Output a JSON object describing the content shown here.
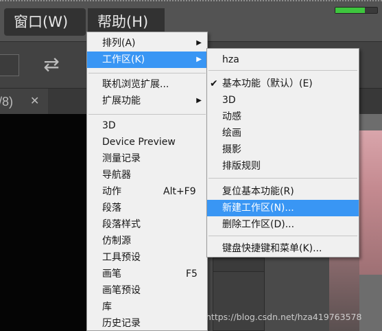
{
  "menubar": {
    "window_label": "窗口(W)",
    "help_label": "帮助(H)",
    "progress_fraction": 0.7,
    "progress_color": "#3ec63e"
  },
  "document_tab": {
    "text": "/8)",
    "close_glyph": "✕"
  },
  "window_menu": {
    "items": [
      {
        "label": "排列(A)",
        "shortcut": "",
        "submenu": true
      },
      {
        "label": "工作区(K)",
        "shortcut": "",
        "submenu": true,
        "highlighted": true
      },
      {
        "label": "联机浏览扩展...",
        "shortcut": ""
      },
      {
        "label": "扩展功能",
        "shortcut": "",
        "submenu": true
      },
      {
        "label": "3D",
        "shortcut": ""
      },
      {
        "label": "Device Preview",
        "shortcut": ""
      },
      {
        "label": "测量记录",
        "shortcut": ""
      },
      {
        "label": "导航器",
        "shortcut": ""
      },
      {
        "label": "动作",
        "shortcut": "Alt+F9"
      },
      {
        "label": "段落",
        "shortcut": ""
      },
      {
        "label": "段落样式",
        "shortcut": ""
      },
      {
        "label": "仿制源",
        "shortcut": ""
      },
      {
        "label": "工具预设",
        "shortcut": ""
      },
      {
        "label": "画笔",
        "shortcut": "F5"
      },
      {
        "label": "画笔预设",
        "shortcut": ""
      },
      {
        "label": "库",
        "shortcut": ""
      },
      {
        "label": "历史记录",
        "shortcut": ""
      }
    ]
  },
  "workspace_submenu": {
    "items": [
      {
        "label": "hza"
      },
      {
        "label": "基本功能（默认）(E)",
        "checked": true
      },
      {
        "label": "3D"
      },
      {
        "label": "动感"
      },
      {
        "label": "绘画"
      },
      {
        "label": "摄影"
      },
      {
        "label": "排版规则"
      },
      {
        "label": "复位基本功能(R)"
      },
      {
        "label": "新建工作区(N)...",
        "highlighted": true
      },
      {
        "label": "删除工作区(D)..."
      },
      {
        "label": "键盘快捷键和菜单(K)..."
      }
    ]
  },
  "glyphs": {
    "submenu_arrow": "▶",
    "checkmark": "✔",
    "swap_arrows": "⇄"
  },
  "watermark": "https://blog.csdn.net/hza419763578",
  "colors": {
    "highlight": "#3996f4",
    "menu_bg": "#f0f0f0",
    "app_bg": "#535353"
  }
}
